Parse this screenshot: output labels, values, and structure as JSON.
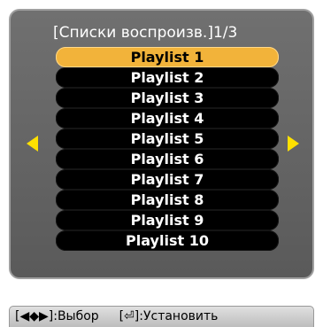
{
  "header": {
    "title": "[Списки воспроизв.]1/3"
  },
  "playlists": [
    {
      "label": "Playlist 1",
      "selected": true
    },
    {
      "label": "Playlist 2",
      "selected": false
    },
    {
      "label": "Playlist 3",
      "selected": false
    },
    {
      "label": "Playlist 4",
      "selected": false
    },
    {
      "label": "Playlist 5",
      "selected": false
    },
    {
      "label": "Playlist 6",
      "selected": false
    },
    {
      "label": "Playlist 7",
      "selected": false
    },
    {
      "label": "Playlist 8",
      "selected": false
    },
    {
      "label": "Playlist 9",
      "selected": false
    },
    {
      "label": "Playlist 10",
      "selected": false
    }
  ],
  "nav": {
    "prev_icon": "left-arrow-icon",
    "next_icon": "right-arrow-icon",
    "arrow_color": "#ffe100"
  },
  "colors": {
    "highlight": "#f2b33a",
    "panel": "#636363",
    "item": "#000000"
  },
  "help": {
    "select": "[◀◆▶]:Выбор",
    "confirm": "[⏎]:Установить"
  }
}
